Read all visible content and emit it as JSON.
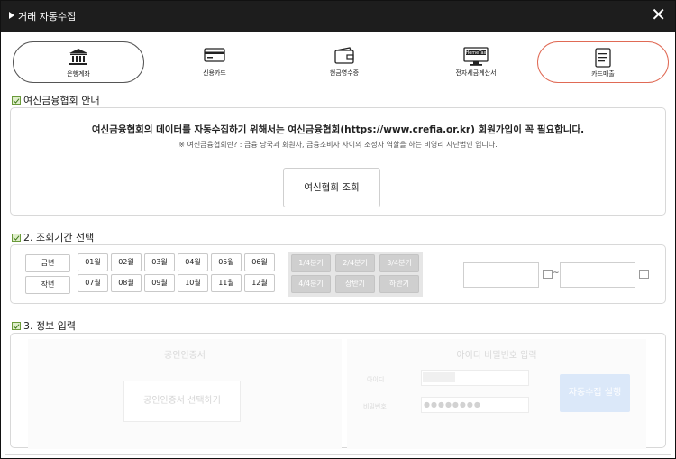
{
  "window": {
    "title": "거래 자동수집",
    "close": "✕"
  },
  "tabs": [
    {
      "label": "은행계좌",
      "icon": "bank-icon"
    },
    {
      "label": "신용카드",
      "icon": "credit-card-icon"
    },
    {
      "label": "현금영수증",
      "icon": "wallet-icon"
    },
    {
      "label": "전자세금계산서",
      "icon": "hometax-monitor-icon",
      "icon_text": "HomeTax"
    },
    {
      "label": "카드매출",
      "icon": "document-icon"
    }
  ],
  "section1": {
    "title": "여신금융협회 안내",
    "main_text": "여신금융협회의 데이터를 자동수집하기 위해서는 여신금융협회(https://www.crefia.or.kr) 회원가입이 꼭 필요합니다.",
    "sub_text": "※ 여신금융협회란? : 금융 당국과 회원사, 금융소비자 사이의 조정자 역할을 하는 비영리 사단법인 입니다.",
    "lookup_button": "여신협회 조회"
  },
  "section2": {
    "title": "2. 조회기간 선택",
    "years": [
      "금년",
      "작년"
    ],
    "months": [
      "01월",
      "02월",
      "03월",
      "04월",
      "05월",
      "06월",
      "07월",
      "08월",
      "09월",
      "10월",
      "11월",
      "12월"
    ],
    "quarters": [
      "1/4분기",
      "2/4분기",
      "3/4분기",
      "4/4분기",
      "상반기",
      "하반기"
    ],
    "start_date": "",
    "end_date": "",
    "separator": "~"
  },
  "section3": {
    "title": "3. 정보 입력",
    "cert_title": "공인인증서",
    "cert_button": "공인인증서 선택하기",
    "id_pw_title": "아이디 비밀번호 입력",
    "id_label": "아이디",
    "pw_label": "비밀번호",
    "pw_mask": "●●●●●●●●",
    "run_button": "자동수집 실행"
  }
}
